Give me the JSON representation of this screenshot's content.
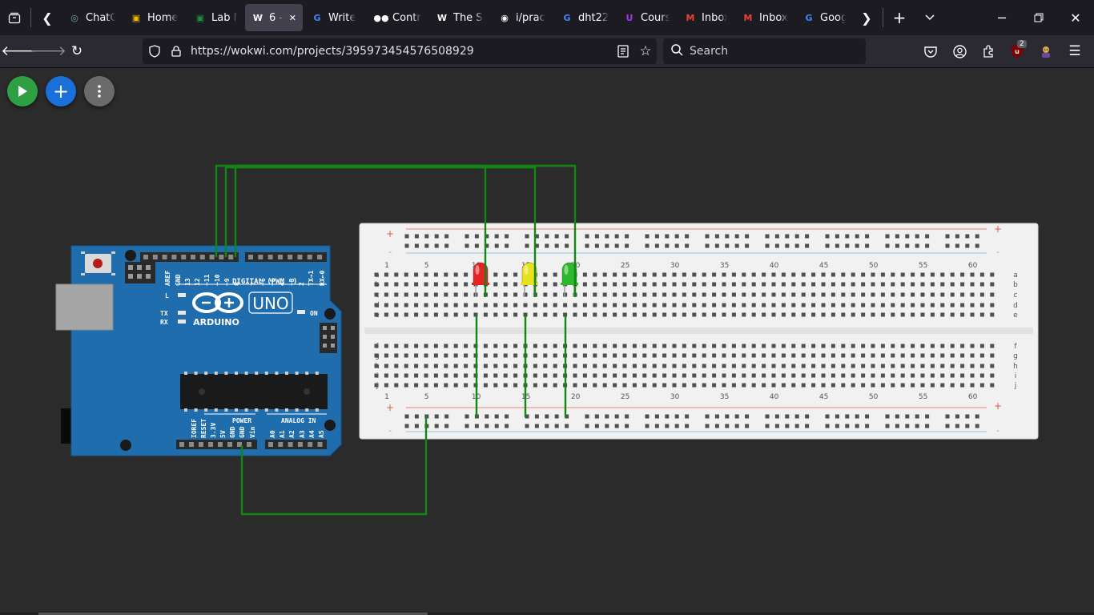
{
  "tabs": [
    {
      "label": "ChatGPT",
      "icon": "chatgpt-icon",
      "color": "#74aa9c",
      "glyph": "◎"
    },
    {
      "label": "Home",
      "icon": "classroom-icon",
      "color": "#f4b400",
      "glyph": "▣"
    },
    {
      "label": "Lab M",
      "icon": "classroom-icon",
      "color": "#1e8e3e",
      "glyph": "▣"
    },
    {
      "label": "6 -",
      "icon": "wokwi-icon",
      "color": "#ffffff",
      "glyph": "W",
      "active": true
    },
    {
      "label": "Write",
      "icon": "google-icon",
      "color": "#4285f4",
      "glyph": "G"
    },
    {
      "label": "Contr",
      "icon": "medium-icon",
      "color": "#ffffff",
      "glyph": "●●"
    },
    {
      "label": "The Se",
      "icon": "wikipedia-icon",
      "color": "#ffffff",
      "glyph": "W"
    },
    {
      "label": "i/prac",
      "icon": "github-icon",
      "color": "#ffffff",
      "glyph": "◉"
    },
    {
      "label": "dht22",
      "icon": "google-icon",
      "color": "#4285f4",
      "glyph": "G"
    },
    {
      "label": "Cours",
      "icon": "udemy-icon",
      "color": "#a435f0",
      "glyph": "U"
    },
    {
      "label": "Inbox",
      "icon": "gmail-icon",
      "color": "#ea4335",
      "glyph": "M"
    },
    {
      "label": "Inbox",
      "icon": "gmail-icon",
      "color": "#ea4335",
      "glyph": "M"
    },
    {
      "label": "Googl",
      "icon": "google-icon",
      "color": "#4285f4",
      "glyph": "G"
    }
  ],
  "address": {
    "url": "https://wokwi.com/projects/395973454576508929"
  },
  "search": {
    "placeholder": "Search"
  },
  "extensions": {
    "badge_count": "2"
  },
  "arduino": {
    "board_name": "UNO",
    "brand": "ARDUINO",
    "digital_label": "DIGITAL (PWM ~)",
    "top_pins": [
      "AREF",
      "GND",
      "13",
      "12",
      "~11",
      "~10",
      "~9",
      "8",
      "7",
      "~6",
      "~5",
      "4",
      "~3",
      "2",
      "TX→1",
      "RX←0"
    ],
    "power_label": "POWER",
    "analog_label": "ANALOG IN",
    "bottom_pins": [
      "IOREF",
      "RESET",
      "3.3V",
      "5V",
      "GND",
      "GND",
      "Vin",
      "A0",
      "A1",
      "A2",
      "A3",
      "A4",
      "A5"
    ],
    "led_labels": [
      "L",
      "TX",
      "RX",
      "ON"
    ]
  },
  "breadboard": {
    "column_numbers": [
      "1",
      "5",
      "10",
      "15",
      "20",
      "25",
      "30",
      "35",
      "40",
      "45",
      "50",
      "55",
      "60"
    ],
    "row_letters_top": [
      "a",
      "b",
      "c",
      "d",
      "e"
    ],
    "row_letters_bottom": [
      "f",
      "g",
      "h",
      "i",
      "j"
    ],
    "plus": "+",
    "minus": "-"
  },
  "leds": [
    {
      "color": "red",
      "fill": "#e52424"
    },
    {
      "color": "yellow",
      "fill": "#e8e21c"
    },
    {
      "color": "green",
      "fill": "#2db82d"
    }
  ],
  "colors": {
    "wire": "#118811",
    "board": "#1f6dad",
    "breadboard": "#f1f1f1"
  }
}
